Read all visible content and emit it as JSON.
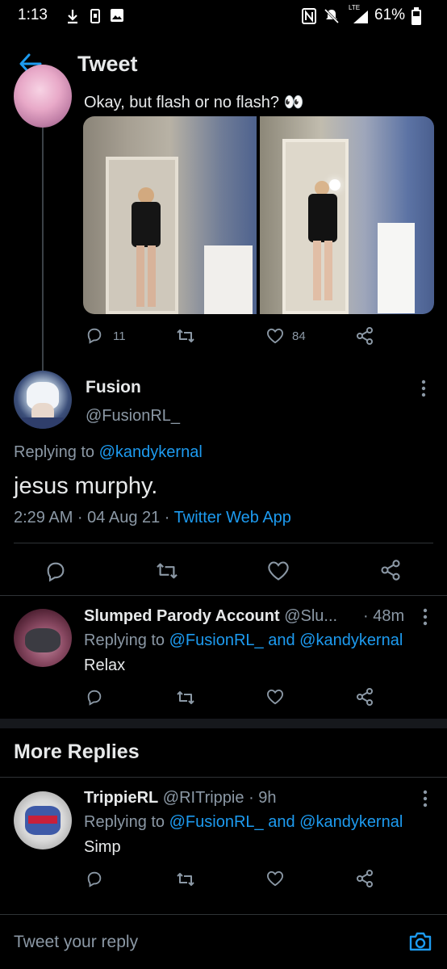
{
  "status_bar": {
    "time": "1:13",
    "battery": "61%",
    "network": "LTE"
  },
  "header": {
    "title": "Tweet"
  },
  "parent_tweet": {
    "text": "Okay, but flash or no flash? 👀",
    "stats": {
      "replies": "11",
      "likes": "84"
    }
  },
  "main_tweet": {
    "display_name": "Fusion",
    "handle": "@FusionRL_",
    "replying_prefix": "Replying to ",
    "replying_to": "@kandykernal",
    "text": "jesus murphy.",
    "time": "2:29 AM · 04 Aug 21 · ",
    "source": "Twitter Web App"
  },
  "replies": [
    {
      "display_name": "Slumped Parody Account",
      "handle": "@Slu...",
      "time": "· 48m",
      "replying_prefix": "Replying to ",
      "replying_a": "@FusionRL_",
      "replying_and": " and ",
      "replying_b": "@kandykernal",
      "text": "Relax"
    },
    {
      "display_name": "TrippieRL",
      "handle": "@RITrippie",
      "time": "· 9h",
      "replying_prefix": "Replying to ",
      "replying_a": "@FusionRL_",
      "replying_and": " and ",
      "replying_b": "@kandykernal",
      "text": "Simp"
    }
  ],
  "more_replies": {
    "title": "More Replies"
  },
  "composer": {
    "placeholder": "Tweet your reply"
  },
  "colors": {
    "accent": "#1d9bf0",
    "background": "#000000",
    "muted": "#8b98a5"
  }
}
